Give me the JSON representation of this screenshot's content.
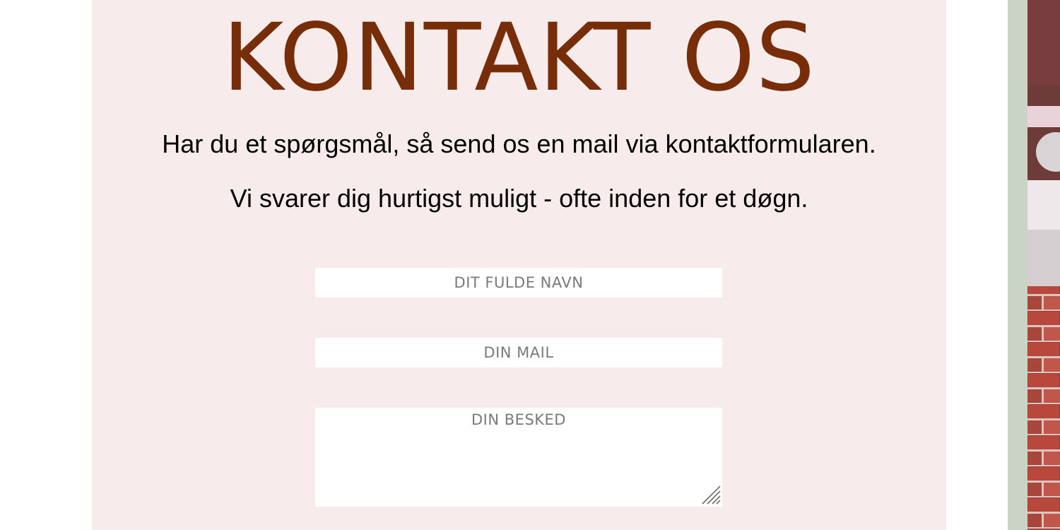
{
  "colors": {
    "panel_bg": "#f7eceb",
    "title": "#772d08",
    "placeholder": "#7a7a7a",
    "side_strip": "#cbd3c6",
    "brick": "#b3463b"
  },
  "contact": {
    "title": "KONTAKT OS",
    "intro_line_1": "Har du et spørgsmål, så send os en mail via kontaktformularen.",
    "intro_line_2": "Vi svarer dig hurtigst muligt - ofte inden for et døgn.",
    "form": {
      "name_placeholder": "DIT FULDE NAVN",
      "email_placeholder": "DIN MAIL",
      "message_placeholder": "DIN BESKED"
    }
  }
}
